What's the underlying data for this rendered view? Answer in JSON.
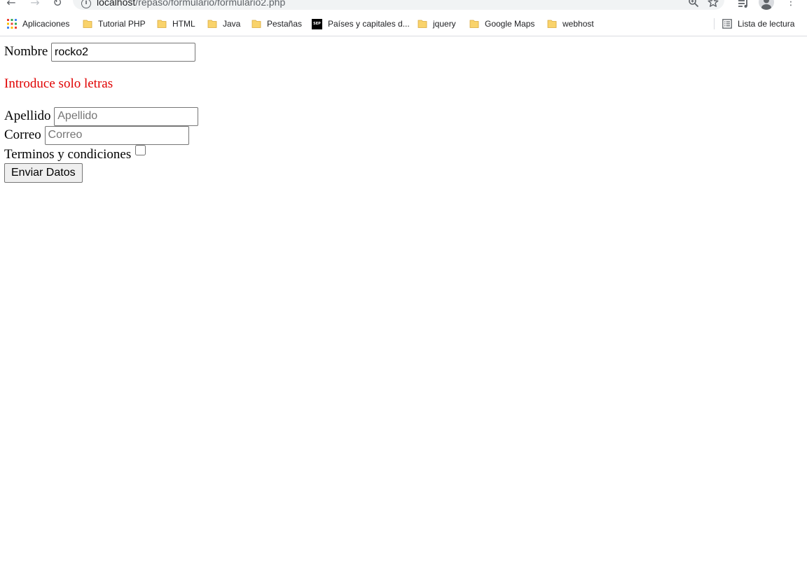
{
  "browser": {
    "url_host": "localhost",
    "url_path": "/repaso/formulario/formulario2.php"
  },
  "bookmarks": {
    "items": [
      {
        "label": "Aplicaciones",
        "icon": "apps-grid-icon"
      },
      {
        "label": "Tutorial PHP",
        "icon": "folder-icon"
      },
      {
        "label": "HTML",
        "icon": "folder-icon"
      },
      {
        "label": "Java",
        "icon": "folder-icon"
      },
      {
        "label": "Pestañas",
        "icon": "folder-icon"
      },
      {
        "label": "Países y capitales d...",
        "icon": "sep-favicon"
      },
      {
        "label": "jquery",
        "icon": "folder-icon"
      },
      {
        "label": "Google Maps",
        "icon": "folder-icon"
      },
      {
        "label": "webhost",
        "icon": "folder-icon"
      }
    ],
    "reading_list": "Lista de lectura",
    "sep_badge": "SEP"
  },
  "form": {
    "nombre_label": "Nombre",
    "nombre_value": "rocko2",
    "error_message": "Introduce solo letras",
    "apellido_label": "Apellido",
    "apellido_placeholder": "Apellido",
    "correo_label": "Correo",
    "correo_placeholder": "Correo",
    "terminos_label": "Terminos y condiciones",
    "submit_label": "Enviar Datos"
  },
  "colors": {
    "error": "#e00000",
    "folder": "#f9d36b"
  }
}
